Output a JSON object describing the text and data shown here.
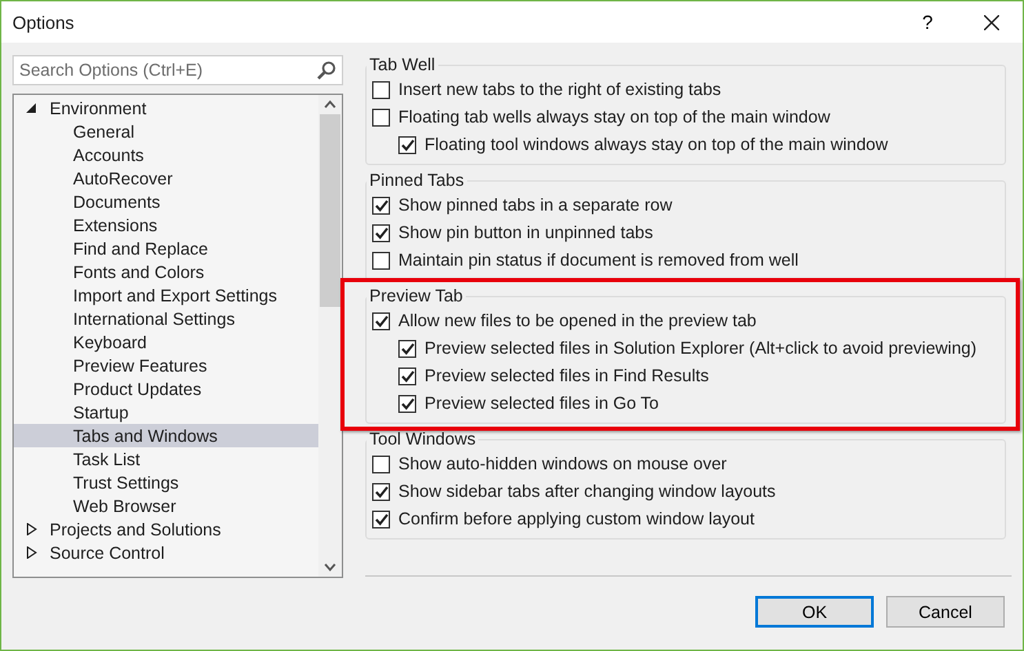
{
  "window": {
    "title": "Options",
    "help": "?"
  },
  "search": {
    "placeholder": "Search Options (Ctrl+E)"
  },
  "tree": [
    {
      "label": "Environment",
      "expanded": true,
      "selected": false,
      "children": [
        {
          "label": "General",
          "selected": false
        },
        {
          "label": "Accounts",
          "selected": false
        },
        {
          "label": "AutoRecover",
          "selected": false
        },
        {
          "label": "Documents",
          "selected": false
        },
        {
          "label": "Extensions",
          "selected": false
        },
        {
          "label": "Find and Replace",
          "selected": false
        },
        {
          "label": "Fonts and Colors",
          "selected": false
        },
        {
          "label": "Import and Export Settings",
          "selected": false
        },
        {
          "label": "International Settings",
          "selected": false
        },
        {
          "label": "Keyboard",
          "selected": false
        },
        {
          "label": "Preview Features",
          "selected": false
        },
        {
          "label": "Product Updates",
          "selected": false
        },
        {
          "label": "Startup",
          "selected": false
        },
        {
          "label": "Tabs and Windows",
          "selected": true
        },
        {
          "label": "Task List",
          "selected": false
        },
        {
          "label": "Trust Settings",
          "selected": false
        },
        {
          "label": "Web Browser",
          "selected": false
        }
      ]
    },
    {
      "label": "Projects and Solutions",
      "expanded": false,
      "selected": false
    },
    {
      "label": "Source Control",
      "expanded": false,
      "selected": false
    }
  ],
  "groups": [
    {
      "title": "Tab Well",
      "highlighted": false,
      "options": [
        {
          "label": "Insert new tabs to the right of existing tabs",
          "checked": false
        },
        {
          "label": "Floating tab wells always stay on top of the main window",
          "checked": false,
          "children": [
            {
              "label": "Floating tool windows always stay on top of the main window",
              "checked": true
            }
          ]
        }
      ]
    },
    {
      "title": "Pinned Tabs",
      "highlighted": false,
      "options": [
        {
          "label": "Show pinned tabs in a separate row",
          "checked": true
        },
        {
          "label": "Show pin button in unpinned tabs",
          "checked": true
        },
        {
          "label": "Maintain pin status if document is removed from well",
          "checked": false
        }
      ]
    },
    {
      "title": "Preview Tab",
      "highlighted": true,
      "options": [
        {
          "label": "Allow new files to be opened in the preview tab",
          "checked": true,
          "children": [
            {
              "label": "Preview selected files in Solution Explorer (Alt+click to avoid previewing)",
              "checked": true
            },
            {
              "label": "Preview selected files in Find Results",
              "checked": true
            },
            {
              "label": "Preview selected files in Go To",
              "checked": true
            }
          ]
        }
      ]
    },
    {
      "title": "Tool Windows",
      "highlighted": false,
      "options": [
        {
          "label": "Show auto-hidden windows on mouse over",
          "checked": false
        },
        {
          "label": "Show sidebar tabs after changing window layouts",
          "checked": true
        },
        {
          "label": "Confirm before applying custom window layout",
          "checked": true
        }
      ]
    }
  ],
  "buttons": [
    {
      "label": "OK",
      "default": true
    },
    {
      "label": "Cancel",
      "default": false
    }
  ]
}
